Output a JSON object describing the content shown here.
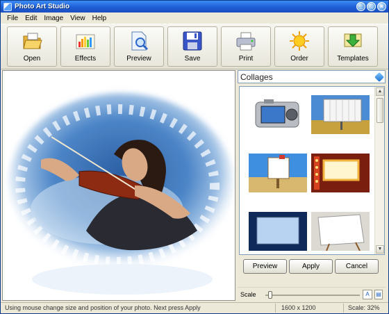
{
  "window": {
    "title": "Photo Art Studio"
  },
  "menu": [
    "File",
    "Edit",
    "Image",
    "View",
    "Help"
  ],
  "toolbar": [
    {
      "label": "Open",
      "icon": "folder-open-icon"
    },
    {
      "label": "Effects",
      "icon": "effects-chart-icon"
    },
    {
      "label": "Preview",
      "icon": "magnifier-document-icon"
    },
    {
      "label": "Save",
      "icon": "floppy-disk-icon"
    },
    {
      "label": "Print",
      "icon": "printer-icon"
    },
    {
      "label": "Order",
      "icon": "sun-icon"
    },
    {
      "label": "Templates",
      "icon": "templates-download-icon"
    }
  ],
  "panel": {
    "category": "Collages",
    "thumbnails": [
      "camera-screen-thumbnail",
      "billboard-field-thumbnail",
      "beach-sign-thumbnail",
      "theater-marquee-thumbnail",
      "projector-screen-thumbnail",
      "easel-canvas-thumbnail"
    ],
    "buttons": {
      "preview": "Preview",
      "apply": "Apply",
      "cancel": "Cancel"
    },
    "scale_label": "Scale",
    "scale_level": 0.05
  },
  "status": {
    "message": "Using mouse change size and position of your photo. Next press Apply",
    "dimensions": "1600 x 1200",
    "scale": "Scale: 32%"
  },
  "colors": {
    "titlebar": "#1f5fd6",
    "window_bg": "#ece9d8",
    "accent_blue": "#1c5ec2"
  }
}
